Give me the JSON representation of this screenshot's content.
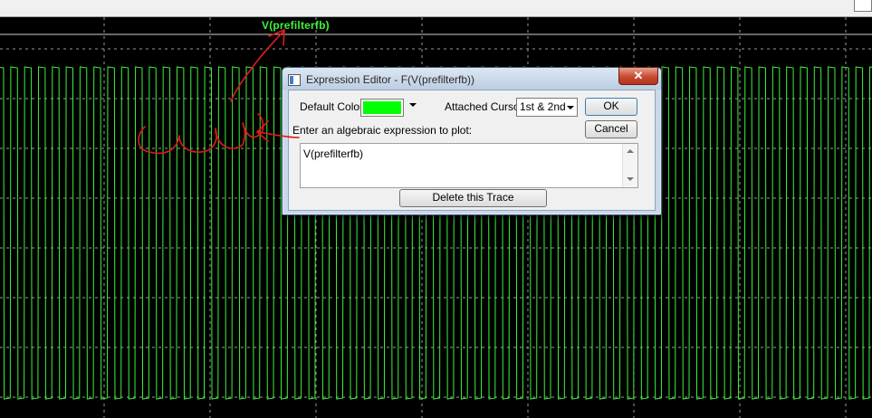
{
  "plot": {
    "trace_label": "V(prefilterfb)",
    "colors": {
      "background": "#000000",
      "trace": "#3cf23c",
      "grid": "#9a9a9a"
    },
    "grid": true
  },
  "dialog": {
    "title": "Expression Editor - F(V(prefilterfb))",
    "close_label": "✕",
    "default_color_label": "Default Color:",
    "default_color_value": "#00ff00",
    "attached_cursor_label": "Attached Cursor:",
    "attached_cursor_value": "1st & 2nd",
    "ok_label": "OK",
    "cancel_label": "Cancel",
    "expression_prompt": "Enter an algebraic expression to plot:",
    "expression_value": "V(prefilterfb)",
    "delete_label": "Delete this Trace"
  },
  "annotation": {
    "color": "#e01a1a"
  },
  "icons": [
    "app-icon",
    "close-icon",
    "chevron-down-icon",
    "scroll-up-icon",
    "scroll-down-icon"
  ]
}
